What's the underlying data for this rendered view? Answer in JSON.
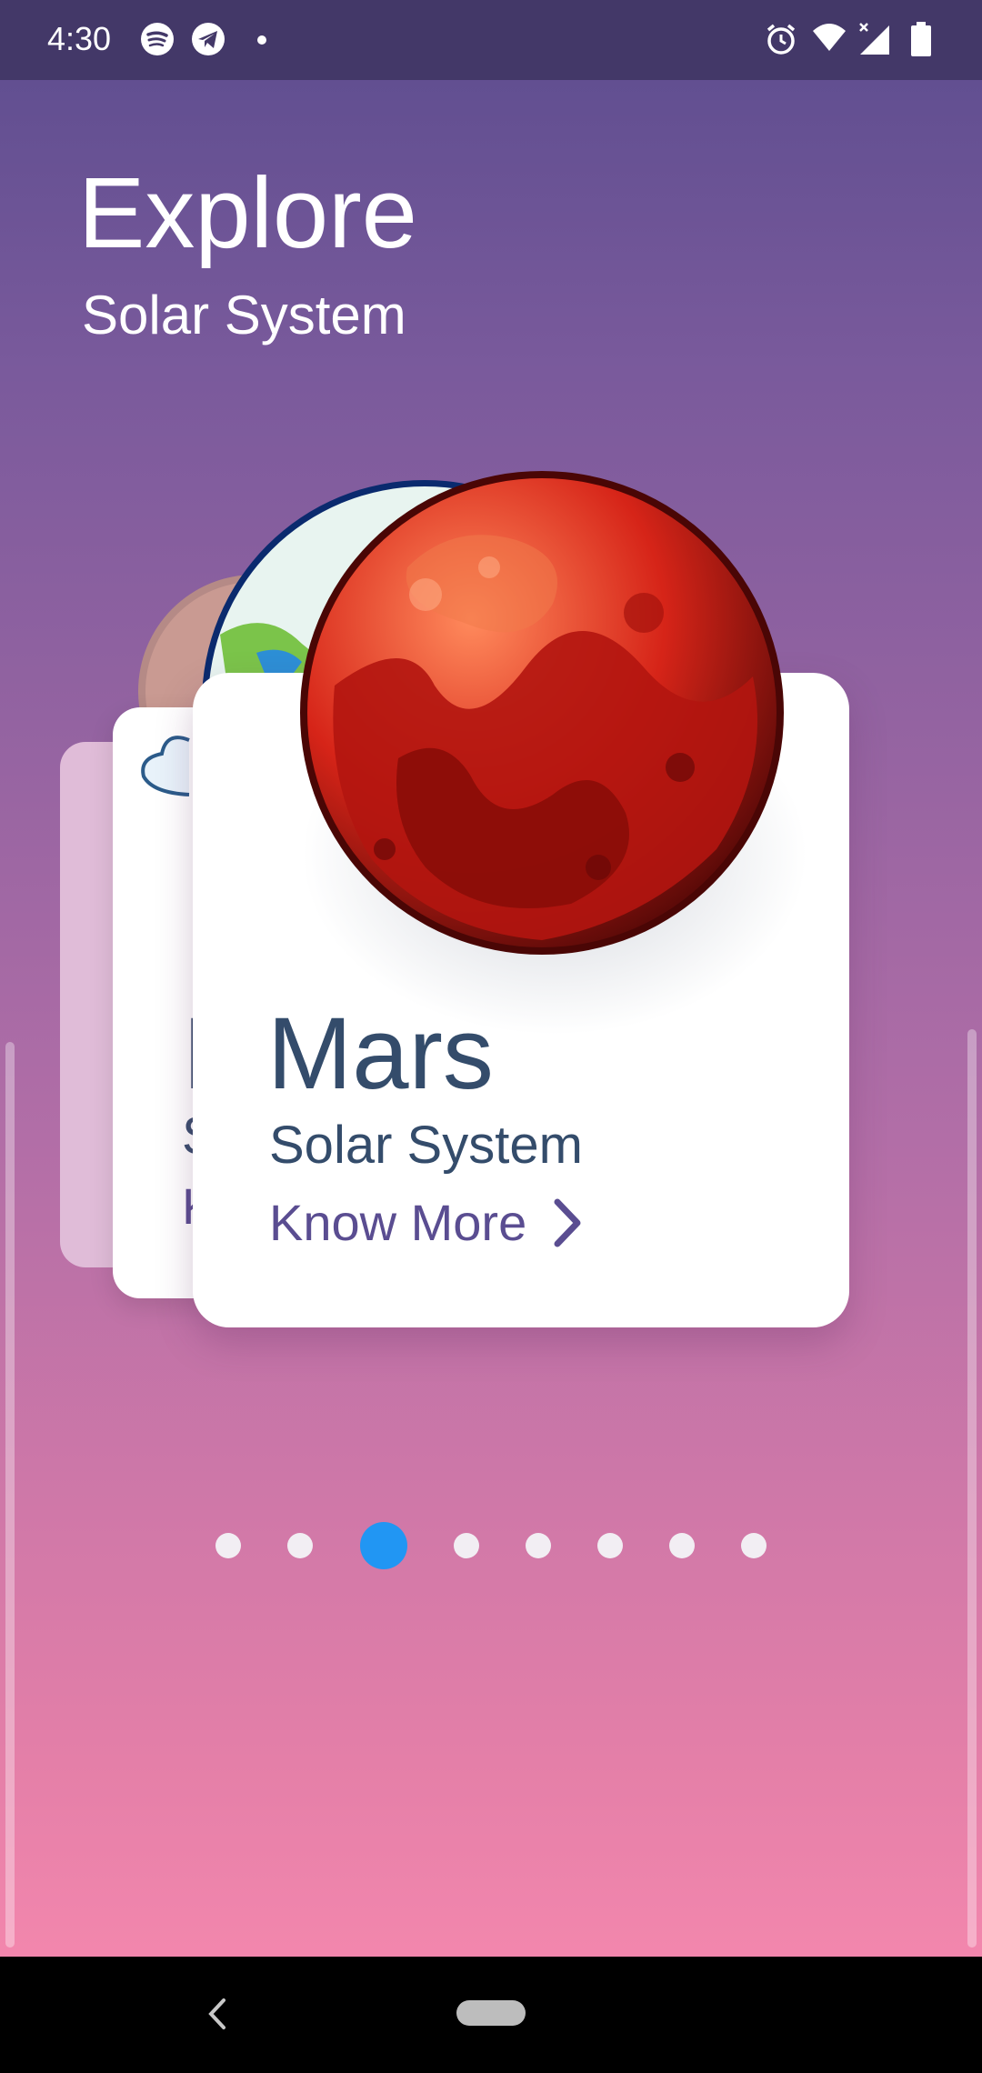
{
  "status_bar": {
    "time": "4:30",
    "left_icons": [
      "spotify-icon",
      "telegram-icon",
      "dot-icon"
    ],
    "right_icons": [
      "alarm-icon",
      "wifi-icon",
      "signal-icon",
      "battery-icon"
    ]
  },
  "header": {
    "title": "Explore",
    "subtitle": "Solar System"
  },
  "cards": [
    {
      "peek_initial": "I",
      "peek_sub": "S",
      "peek_link": "K"
    },
    {
      "name": "Mars",
      "subtitle": "Solar System",
      "link_label": "Know More",
      "link_icon": "chevron-right-icon"
    }
  ],
  "pager": {
    "count": 8,
    "active_index": 2,
    "active_color": "#2196f3"
  },
  "nav_bar": {
    "icons": [
      "back-icon",
      "home-pill-icon"
    ]
  },
  "colors": {
    "title_text": "#344c6b",
    "link_text": "#5a4d91"
  }
}
